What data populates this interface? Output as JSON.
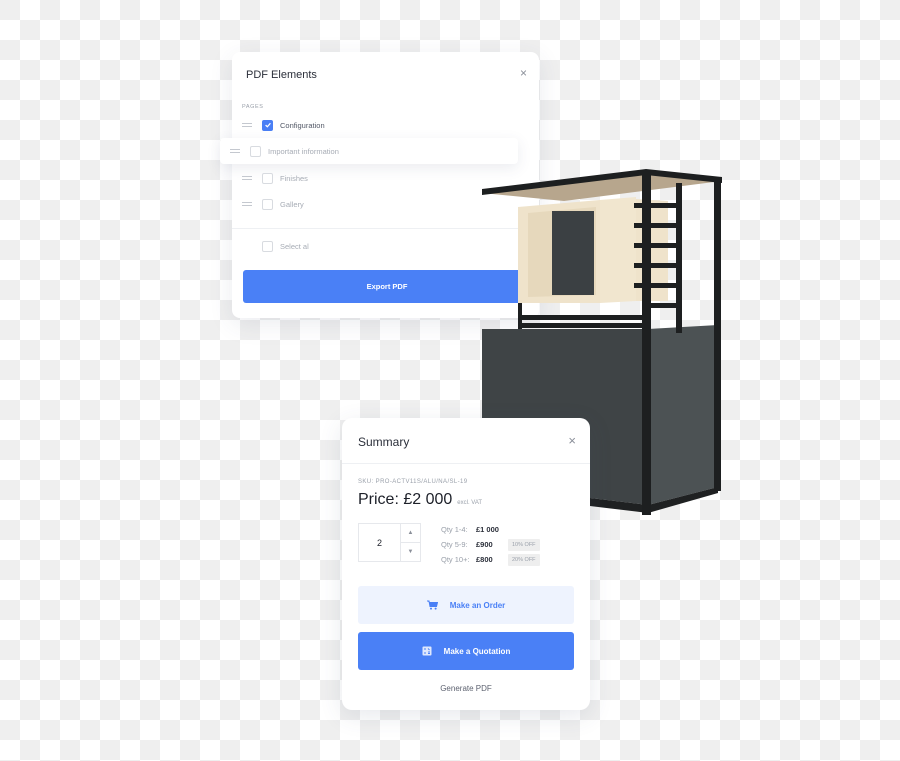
{
  "pdf_panel": {
    "title": "PDF Elements",
    "close_icon": "×",
    "section_label": "PAGES",
    "pages": [
      {
        "label": "Configuration",
        "checked": true
      },
      {
        "label": "Important information",
        "checked": false,
        "dragging": true
      },
      {
        "label": "Finishes",
        "checked": false
      },
      {
        "label": "Gallery",
        "checked": false
      }
    ],
    "select_all_label": "Select al",
    "export_label": "Export PDF"
  },
  "summary": {
    "title": "Summary",
    "close_icon": "×",
    "sku": "SKU: PRO-ACTV11S/ALU/NA/SL-19",
    "price": "Price: £2 000",
    "price_note": "excl. VAT",
    "quantity": "2",
    "up_icon": "▲",
    "down_icon": "▼",
    "tiers": [
      {
        "qty": "Qty 1-4:",
        "price": "£1 000",
        "discount": ""
      },
      {
        "qty": "Qty 5-9:",
        "price": "£900",
        "discount": "10% OFF"
      },
      {
        "qty": "Qty 10+:",
        "price": "£800",
        "discount": "20% OFF"
      }
    ],
    "order_label": "Make an Order",
    "quotation_label": "Make a Quotation",
    "generate_pdf_label": "Generate PDF"
  },
  "colors": {
    "accent": "#4a80f6",
    "accent_light": "#eef3fe"
  }
}
